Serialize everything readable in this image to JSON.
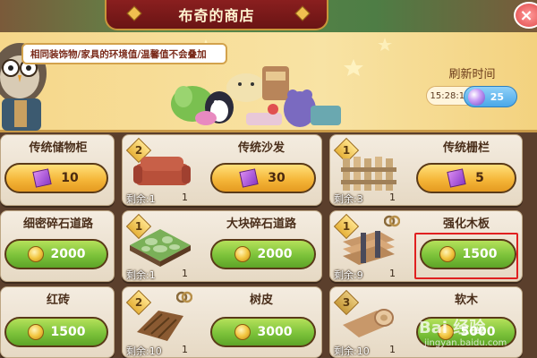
{
  "shop": {
    "title": "布奇的商店",
    "close_label": "×"
  },
  "banner": {
    "notice": "相同装饰物/家具的环境值/温馨值不会叠加",
    "refresh_label": "刷新时间",
    "refresh_timer": "15:28:15",
    "refresh_cost": "25"
  },
  "items": [
    {
      "name": "传统储物柜",
      "price": "10",
      "currency": "ticket",
      "button_color": "yellow",
      "tier": "",
      "remaining": "",
      "count": ""
    },
    {
      "name": "传统沙发",
      "price": "30",
      "currency": "ticket",
      "button_color": "yellow",
      "tier": "2",
      "remaining": "剩余:1",
      "count": "1"
    },
    {
      "name": "传统栅栏",
      "price": "5",
      "currency": "ticket",
      "button_color": "yellow",
      "tier": "1",
      "remaining": "剩余:3",
      "count": "1"
    },
    {
      "name": "细密碎石道路",
      "price": "2000",
      "currency": "coin",
      "button_color": "green",
      "tier": "",
      "remaining": "",
      "count": ""
    },
    {
      "name": "大块碎石道路",
      "price": "2000",
      "currency": "coin",
      "button_color": "green",
      "tier": "1",
      "remaining": "剩余:1",
      "count": "1"
    },
    {
      "name": "强化木板",
      "price": "1500",
      "currency": "coin",
      "button_color": "green",
      "tier": "1",
      "remaining": "剩余:9",
      "count": "1"
    },
    {
      "name": "红砖",
      "price": "1500",
      "currency": "coin",
      "button_color": "green",
      "tier": "",
      "remaining": "",
      "count": ""
    },
    {
      "name": "树皮",
      "price": "3000",
      "currency": "coin",
      "button_color": "green",
      "tier": "2",
      "remaining": "剩余:10",
      "count": "1"
    },
    {
      "name": "软木",
      "price": "5000",
      "currency": "coin",
      "button_color": "green",
      "tier": "3",
      "remaining": "剩余:10",
      "count": "1"
    }
  ],
  "watermark": {
    "text": "Bai 经验",
    "url": "jingyan.baidu.com"
  },
  "colors": {
    "highlight_box": "#e02020",
    "title_plate": "#8a1f1f",
    "price_green": "#7cc23a",
    "price_yellow": "#f5b73a"
  }
}
